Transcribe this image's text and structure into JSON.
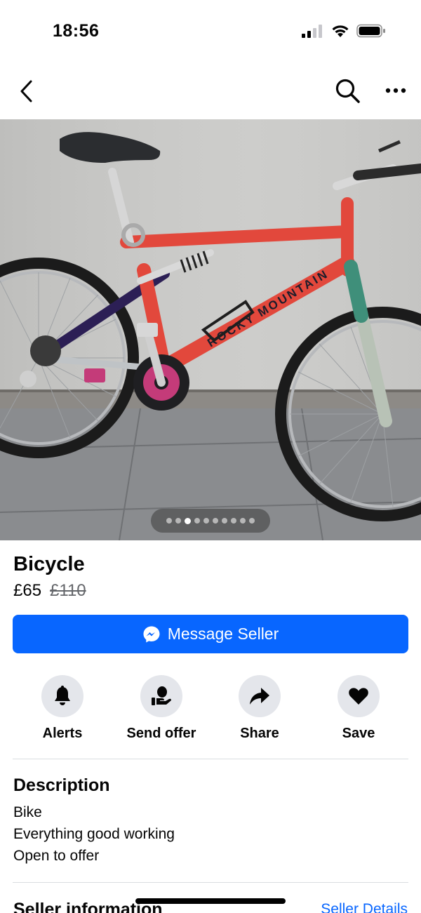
{
  "status_bar": {
    "time": "18:56",
    "icons": [
      "signal-icon",
      "wifi-icon",
      "battery-icon"
    ]
  },
  "nav": {
    "icons": [
      "back-chevron-icon",
      "search-icon",
      "more-icon"
    ]
  },
  "listing": {
    "photo": {
      "frame_brand_text": "ROCKY MOUNTAIN",
      "page_count": 10,
      "active_page": 3
    },
    "title": "Bicycle",
    "price": "£65",
    "original_price": "£110"
  },
  "message_button": {
    "label": "Message Seller",
    "icon": "messenger-icon",
    "color": "#0866ff"
  },
  "actions": [
    {
      "label": "Alerts",
      "icon": "bell-icon"
    },
    {
      "label": "Send offer",
      "icon": "offer-hand-icon"
    },
    {
      "label": "Share",
      "icon": "share-arrow-icon"
    },
    {
      "label": "Save",
      "icon": "heart-icon"
    }
  ],
  "description": {
    "heading": "Description",
    "lines": [
      "Bike",
      "Everything good working",
      "Open to offer"
    ]
  },
  "seller": {
    "heading": "Seller information",
    "link": "Seller Details"
  }
}
